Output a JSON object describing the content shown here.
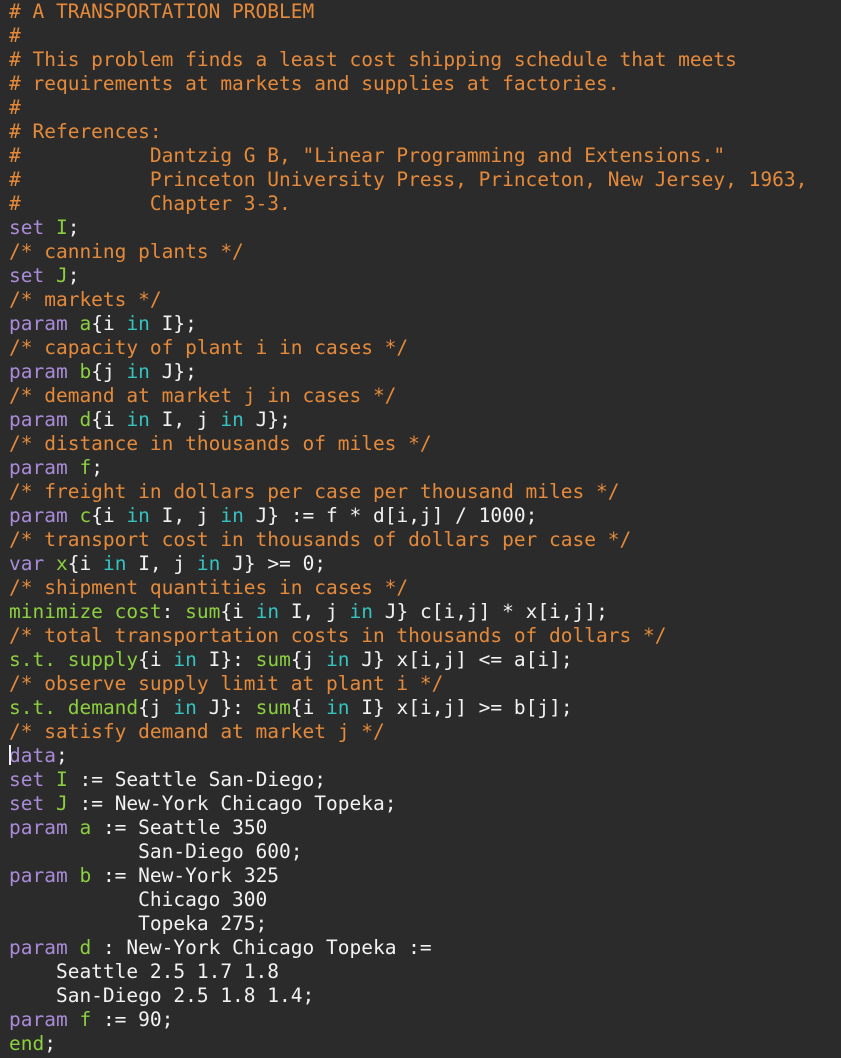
{
  "editor": {
    "language": "GMPL",
    "theme_colors": {
      "background": "#2b2b2b",
      "text": "#f2f2f2",
      "comment": "#e58a3b",
      "keyword_purple": "#a98bd8",
      "keyword_green": "#8ccf3f",
      "keyword_in": "#33c3c0"
    },
    "lines": [
      [
        {
          "s": "c",
          "t": "# A TRANSPORTATION PROBLEM"
        }
      ],
      [
        {
          "s": "c",
          "t": "#"
        }
      ],
      [
        {
          "s": "c",
          "t": "# This problem finds a least cost shipping schedule that meets"
        }
      ],
      [
        {
          "s": "c",
          "t": "# requirements at markets and supplies at factories."
        }
      ],
      [
        {
          "s": "c",
          "t": "#"
        }
      ],
      [
        {
          "s": "c",
          "t": "# References:"
        }
      ],
      [
        {
          "s": "c",
          "t": "#           Dantzig G B, \"Linear Programming and Extensions.\""
        }
      ],
      [
        {
          "s": "c",
          "t": "#           Princeton University Press, Princeton, New Jersey, 1963,"
        }
      ],
      [
        {
          "s": "c",
          "t": "#           Chapter 3-3."
        }
      ],
      [
        {
          "s": "k",
          "t": "set"
        },
        {
          "s": "t",
          "t": " "
        },
        {
          "s": "n",
          "t": "I"
        },
        {
          "s": "t",
          "t": ";"
        }
      ],
      [
        {
          "s": "c",
          "t": "/* canning plants */"
        }
      ],
      [
        {
          "s": "k",
          "t": "set"
        },
        {
          "s": "t",
          "t": " "
        },
        {
          "s": "n",
          "t": "J"
        },
        {
          "s": "t",
          "t": ";"
        }
      ],
      [
        {
          "s": "c",
          "t": "/* markets */"
        }
      ],
      [
        {
          "s": "k",
          "t": "param"
        },
        {
          "s": "t",
          "t": " "
        },
        {
          "s": "n",
          "t": "a"
        },
        {
          "s": "t",
          "t": "{i "
        },
        {
          "s": "kt",
          "t": "in"
        },
        {
          "s": "t",
          "t": " I};"
        }
      ],
      [
        {
          "s": "c",
          "t": "/* capacity of plant i in cases */"
        }
      ],
      [
        {
          "s": "k",
          "t": "param"
        },
        {
          "s": "t",
          "t": " "
        },
        {
          "s": "n",
          "t": "b"
        },
        {
          "s": "t",
          "t": "{j "
        },
        {
          "s": "kt",
          "t": "in"
        },
        {
          "s": "t",
          "t": " J};"
        }
      ],
      [
        {
          "s": "c",
          "t": "/* demand at market j in cases */"
        }
      ],
      [
        {
          "s": "k",
          "t": "param"
        },
        {
          "s": "t",
          "t": " "
        },
        {
          "s": "n",
          "t": "d"
        },
        {
          "s": "t",
          "t": "{i "
        },
        {
          "s": "kt",
          "t": "in"
        },
        {
          "s": "t",
          "t": " I, j "
        },
        {
          "s": "kt",
          "t": "in"
        },
        {
          "s": "t",
          "t": " J};"
        }
      ],
      [
        {
          "s": "c",
          "t": "/* distance in thousands of miles */"
        }
      ],
      [
        {
          "s": "k",
          "t": "param"
        },
        {
          "s": "t",
          "t": " "
        },
        {
          "s": "n",
          "t": "f"
        },
        {
          "s": "t",
          "t": ";"
        }
      ],
      [
        {
          "s": "c",
          "t": "/* freight in dollars per case per thousand miles */"
        }
      ],
      [
        {
          "s": "k",
          "t": "param"
        },
        {
          "s": "t",
          "t": " "
        },
        {
          "s": "n",
          "t": "c"
        },
        {
          "s": "t",
          "t": "{i "
        },
        {
          "s": "kt",
          "t": "in"
        },
        {
          "s": "t",
          "t": " I, j "
        },
        {
          "s": "kt",
          "t": "in"
        },
        {
          "s": "t",
          "t": " J} := f * d[i,j] / 1000;"
        }
      ],
      [
        {
          "s": "c",
          "t": "/* transport cost in thousands of dollars per case */"
        }
      ],
      [
        {
          "s": "k",
          "t": "var"
        },
        {
          "s": "t",
          "t": " "
        },
        {
          "s": "n",
          "t": "x"
        },
        {
          "s": "t",
          "t": "{i "
        },
        {
          "s": "kt",
          "t": "in"
        },
        {
          "s": "t",
          "t": " I, j "
        },
        {
          "s": "kt",
          "t": "in"
        },
        {
          "s": "t",
          "t": " J} >= 0;"
        }
      ],
      [
        {
          "s": "c",
          "t": "/* shipment quantities in cases */"
        }
      ],
      [
        {
          "s": "kg",
          "t": "minimize"
        },
        {
          "s": "t",
          "t": " "
        },
        {
          "s": "n",
          "t": "cost"
        },
        {
          "s": "t",
          "t": ": "
        },
        {
          "s": "kg",
          "t": "sum"
        },
        {
          "s": "t",
          "t": "{i "
        },
        {
          "s": "kt",
          "t": "in"
        },
        {
          "s": "t",
          "t": " I, j "
        },
        {
          "s": "kt",
          "t": "in"
        },
        {
          "s": "t",
          "t": " J} c[i,j] * x[i,j];"
        }
      ],
      [
        {
          "s": "c",
          "t": "/* total transportation costs in thousands of dollars */"
        }
      ],
      [
        {
          "s": "kg",
          "t": "s.t."
        },
        {
          "s": "t",
          "t": " "
        },
        {
          "s": "n",
          "t": "supply"
        },
        {
          "s": "t",
          "t": "{i "
        },
        {
          "s": "kt",
          "t": "in"
        },
        {
          "s": "t",
          "t": " I}: "
        },
        {
          "s": "kg",
          "t": "sum"
        },
        {
          "s": "t",
          "t": "{j "
        },
        {
          "s": "kt",
          "t": "in"
        },
        {
          "s": "t",
          "t": " J} x[i,j] <= a[i];"
        }
      ],
      [
        {
          "s": "c",
          "t": "/* observe supply limit at plant i */"
        }
      ],
      [
        {
          "s": "kg",
          "t": "s.t."
        },
        {
          "s": "t",
          "t": " "
        },
        {
          "s": "n",
          "t": "demand"
        },
        {
          "s": "t",
          "t": "{j "
        },
        {
          "s": "kt",
          "t": "in"
        },
        {
          "s": "t",
          "t": " J}: "
        },
        {
          "s": "kg",
          "t": "sum"
        },
        {
          "s": "t",
          "t": "{i "
        },
        {
          "s": "kt",
          "t": "in"
        },
        {
          "s": "t",
          "t": " I} x[i,j] >= b[j];"
        }
      ],
      [
        {
          "s": "c",
          "t": "/* satisfy demand at market j */"
        }
      ],
      [
        {
          "s": "k",
          "t": "data"
        },
        {
          "s": "t",
          "t": ";"
        }
      ],
      [
        {
          "s": "k",
          "t": "set"
        },
        {
          "s": "t",
          "t": " "
        },
        {
          "s": "n",
          "t": "I"
        },
        {
          "s": "t",
          "t": " := Seattle San-Diego;"
        }
      ],
      [
        {
          "s": "k",
          "t": "set"
        },
        {
          "s": "t",
          "t": " "
        },
        {
          "s": "n",
          "t": "J"
        },
        {
          "s": "t",
          "t": " := New-York Chicago Topeka;"
        }
      ],
      [
        {
          "s": "k",
          "t": "param"
        },
        {
          "s": "t",
          "t": " "
        },
        {
          "s": "n",
          "t": "a"
        },
        {
          "s": "t",
          "t": " := Seattle 350"
        }
      ],
      [
        {
          "s": "t",
          "t": "           San-Diego 600;"
        }
      ],
      [
        {
          "s": "k",
          "t": "param"
        },
        {
          "s": "t",
          "t": " "
        },
        {
          "s": "n",
          "t": "b"
        },
        {
          "s": "t",
          "t": " := New-York 325"
        }
      ],
      [
        {
          "s": "t",
          "t": "           Chicago 300"
        }
      ],
      [
        {
          "s": "t",
          "t": "           Topeka 275;"
        }
      ],
      [
        {
          "s": "k",
          "t": "param"
        },
        {
          "s": "t",
          "t": " "
        },
        {
          "s": "n",
          "t": "d"
        },
        {
          "s": "t",
          "t": " : New-York Chicago Topeka :="
        }
      ],
      [
        {
          "s": "t",
          "t": "    Seattle 2.5 1.7 1.8"
        }
      ],
      [
        {
          "s": "t",
          "t": "    San-Diego 2.5 1.8 1.4;"
        }
      ],
      [
        {
          "s": "k",
          "t": "param"
        },
        {
          "s": "t",
          "t": " "
        },
        {
          "s": "n",
          "t": "f"
        },
        {
          "s": "t",
          "t": " := 90;"
        }
      ],
      [
        {
          "s": "kg",
          "t": "end"
        },
        {
          "s": "t",
          "t": ";"
        }
      ]
    ]
  }
}
